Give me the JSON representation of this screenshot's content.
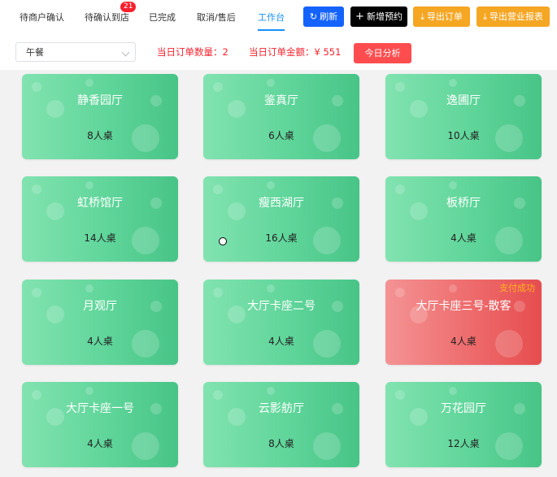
{
  "tabs": [
    {
      "label": "待商户确认"
    },
    {
      "label": "待确认到店",
      "badge": "21"
    },
    {
      "label": "已完成"
    },
    {
      "label": "取消/售后"
    },
    {
      "label": "工作台",
      "active": true
    }
  ],
  "buttons": {
    "refresh": {
      "label": "刷新",
      "icon": "refresh-icon"
    },
    "new_booking": {
      "label": "新增预约",
      "icon": "plus-icon"
    },
    "export_orders": {
      "label": "导出订单",
      "icon": "download-icon"
    },
    "export_report": {
      "label": "导出营业报表",
      "icon": "download-icon"
    }
  },
  "filter": {
    "meal_select": "午餐",
    "order_count_label": "当日订单数量：",
    "order_count": "2",
    "order_amount_label": "当日订单金额：",
    "order_amount": "¥ 551",
    "analyze_label": "今日分析"
  },
  "rooms": [
    {
      "name": "静香园厅",
      "seats": "8人桌",
      "status": ""
    },
    {
      "name": "鉴真厅",
      "seats": "6人桌",
      "status": ""
    },
    {
      "name": "逸圃厅",
      "seats": "10人桌",
      "status": ""
    },
    {
      "name": "虹桥馆厅",
      "seats": "14人桌",
      "status": ""
    },
    {
      "name": "瘦西湖厅",
      "seats": "16人桌",
      "status": ""
    },
    {
      "name": "板桥厅",
      "seats": "4人桌",
      "status": ""
    },
    {
      "name": "月观厅",
      "seats": "4人桌",
      "status": ""
    },
    {
      "name": "大厅卡座二号",
      "seats": "4人桌",
      "status": ""
    },
    {
      "name": "大厅卡座三号-散客",
      "seats": "4人桌",
      "status": "支付成功"
    },
    {
      "name": "大厅卡座一号",
      "seats": "4人桌",
      "status": ""
    },
    {
      "name": "云影舫厅",
      "seats": "8人桌",
      "status": ""
    },
    {
      "name": "万花园厅",
      "seats": "12人桌",
      "status": ""
    }
  ],
  "colors": {
    "card_green": "#5fd59a",
    "card_red": "#ee6b6c",
    "status_text": "#ffb020",
    "accent_blue": "#1463ff",
    "stat_red": "#f5222d"
  }
}
